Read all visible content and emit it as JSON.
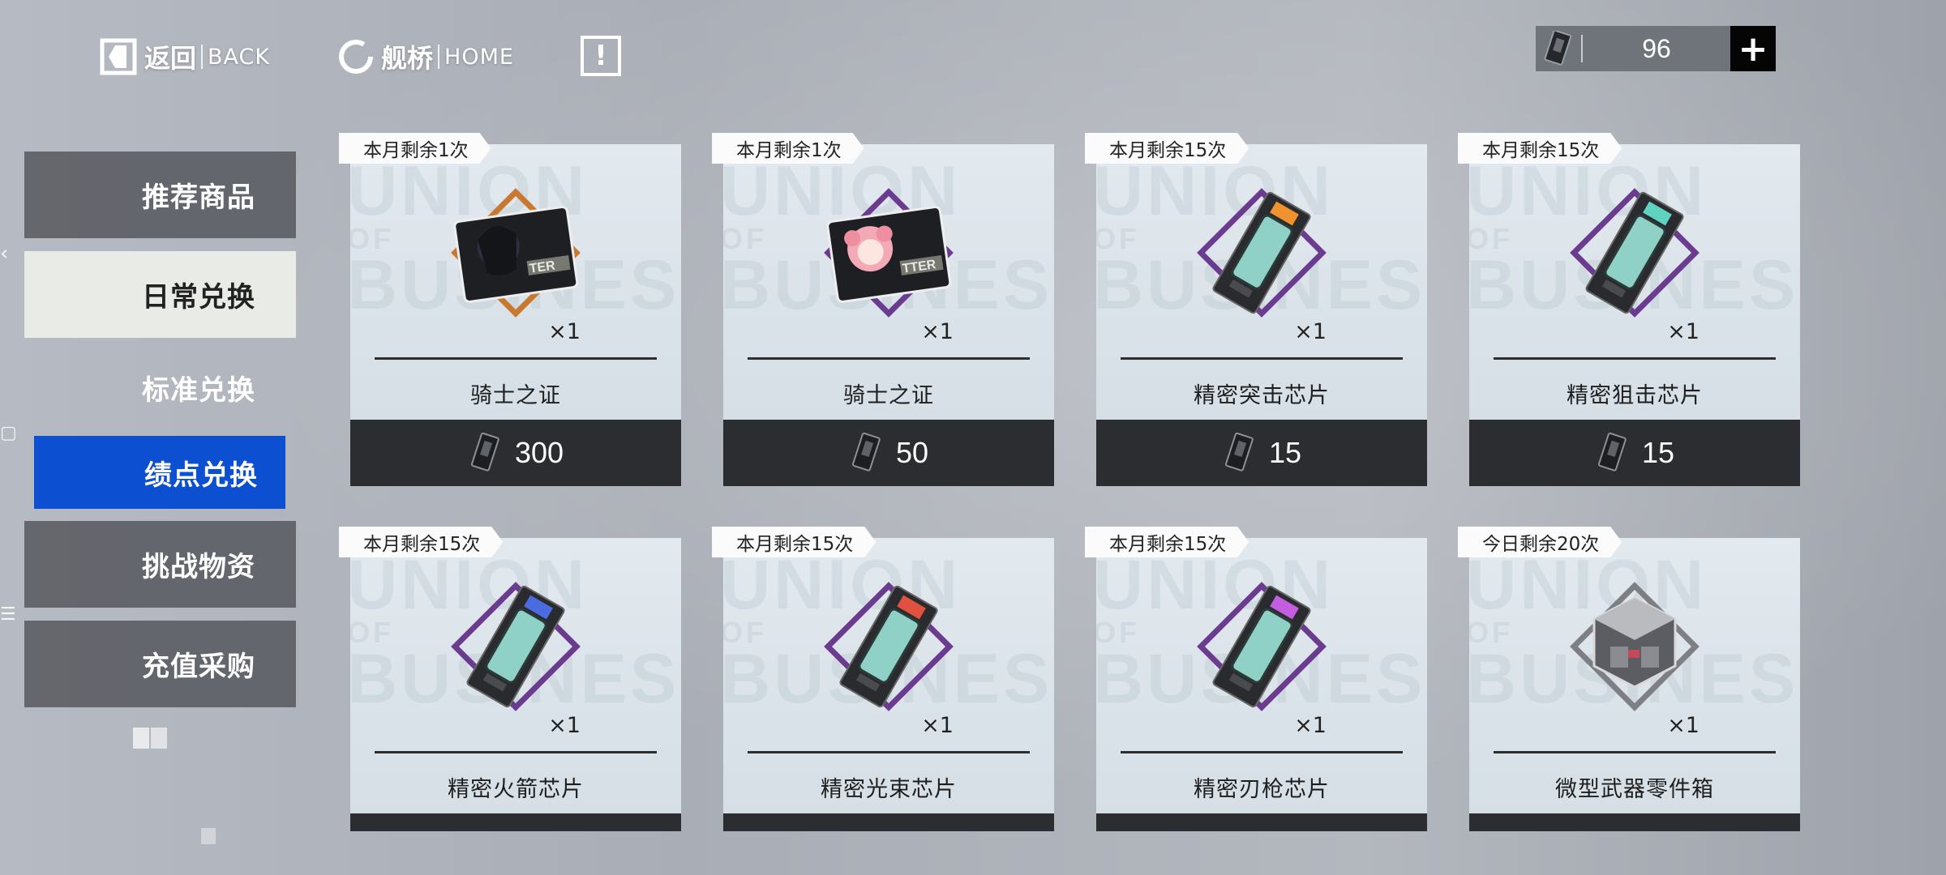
{
  "nav": {
    "back_zh": "返回",
    "back_en": "BACK",
    "home_zh": "舰桥",
    "home_en": "HOME",
    "notice": "!"
  },
  "currency": {
    "value": "96",
    "plus": "+"
  },
  "menu": {
    "items": [
      {
        "label": "推荐商品"
      },
      {
        "label": "日常兑换"
      },
      {
        "label": "标准兑换"
      },
      {
        "label": "绩点兑换"
      },
      {
        "label": "挑战物资"
      },
      {
        "label": "充值采购"
      }
    ]
  },
  "watermark": {
    "l1": "UNION",
    "l2": "OF",
    "l3": "BUSINESS"
  },
  "items": [
    {
      "limit": "本月剩余1次",
      "qty": "×1",
      "name": "骑士之证",
      "price": "300",
      "icon": "knight-card-dark-icon",
      "frame_color": "#c9782f"
    },
    {
      "limit": "本月剩余1次",
      "qty": "×1",
      "name": "骑士之证",
      "price": "50",
      "icon": "knight-card-pink-icon",
      "frame_color": "#6a3b8f"
    },
    {
      "limit": "本月剩余15次",
      "qty": "×1",
      "name": "精密突击芯片",
      "price": "15",
      "icon": "assault-chip-icon",
      "frame_color": "#6a3b8f",
      "chip_tab": "#f0932f"
    },
    {
      "limit": "本月剩余15次",
      "qty": "×1",
      "name": "精密狙击芯片",
      "price": "15",
      "icon": "sniper-chip-icon",
      "frame_color": "#6a3b8f",
      "chip_tab": "#5fd2c0"
    },
    {
      "limit": "本月剩余15次",
      "qty": "×1",
      "name": "精密火箭芯片",
      "icon": "rocket-chip-icon",
      "frame_color": "#6a3b8f",
      "chip_tab": "#4a6ce0"
    },
    {
      "limit": "本月剩余15次",
      "qty": "×1",
      "name": "精密光束芯片",
      "icon": "beam-chip-icon",
      "frame_color": "#6a3b8f",
      "chip_tab": "#e0523f"
    },
    {
      "limit": "本月剩余15次",
      "qty": "×1",
      "name": "精密刃枪芯片",
      "icon": "blade-gun-chip-icon",
      "frame_color": "#6a3b8f",
      "chip_tab": "#c45de0"
    },
    {
      "limit": "今日剩余20次",
      "qty": "×1",
      "name": "微型武器零件箱",
      "icon": "weapon-parts-box-icon",
      "frame_color": "#7d7f84"
    }
  ]
}
